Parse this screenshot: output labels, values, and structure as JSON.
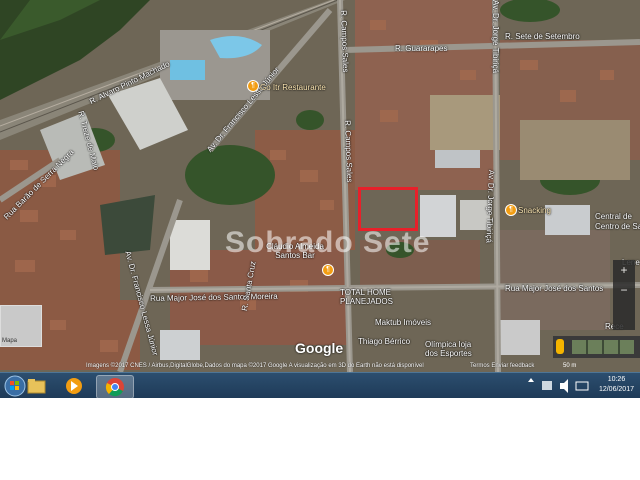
{
  "map": {
    "street_labels": {
      "alvaro": "R. Alvaro Pinto Machado",
      "paulo_cunha": "Av. Dr. Francisco Lessa Júnior",
      "campos_sales": "R. Campos Sales",
      "guararapes": "R. Guararapes",
      "sete_setembro": "R. Sete de Setembro",
      "hemlo": "R. Sete de Setembro",
      "joao_ramalho": "Rua Major José dos Santos Moreira",
      "santos_left": "Rua Major José dos Santos Moreira",
      "major_right": "Rua Major José dos Santos",
      "joaquim": "Av. Dr. Jorge Tibiriçá",
      "dorival": "Av. Dr. Jorge Tibiriçá",
      "coronel": "Rua Barão de Serra Negra",
      "treze": "R. Treze de Maio",
      "vieira": "Av. Dr. Francisco Lessa Júnior",
      "sao_paulo": "R. Santa Cruz",
      "campos_sales2": "R. Campos Sales"
    },
    "pois": {
      "go_restaurante": "Go Itr Restaurante",
      "snacking": "Snacking",
      "central": "Central de",
      "cidade": "Centro de Saúde",
      "almeida_bar": "Cláudio Almeida Santos Bar",
      "total_home": "TOTAL HOME PLANEJADOS",
      "maktub": "Maktub Imóveis",
      "thiago": "Thiago Bérrico",
      "olimpica": "Olímpica loja dos Esportes",
      "lene": "Lene",
      "rece": "Rece"
    },
    "poi_glyph": "¶",
    "watermark": "Sobrado Sete",
    "google_logo": "Google",
    "attribution": "Imagens ©2017 CNES / Airbus,DigitalGlobe,Dados do mapa ©2017 Google   A visualização em 3D do Earth não está disponível",
    "attribution_right": "Termos   Enviar feedback",
    "scale": "50 m",
    "minimap_label": "Mapa",
    "zoom_in": "+",
    "zoom_out": "−"
  },
  "taskbar": {
    "time": "10:26",
    "date": "12/06/2017",
    "items": [
      {
        "name": "start-button"
      },
      {
        "name": "file-explorer"
      },
      {
        "name": "media-player"
      },
      {
        "name": "chrome"
      }
    ]
  },
  "colors": {
    "highlight_box": "#e8202a",
    "poi": "#f29d12",
    "taskbar": "#1e3a57"
  }
}
